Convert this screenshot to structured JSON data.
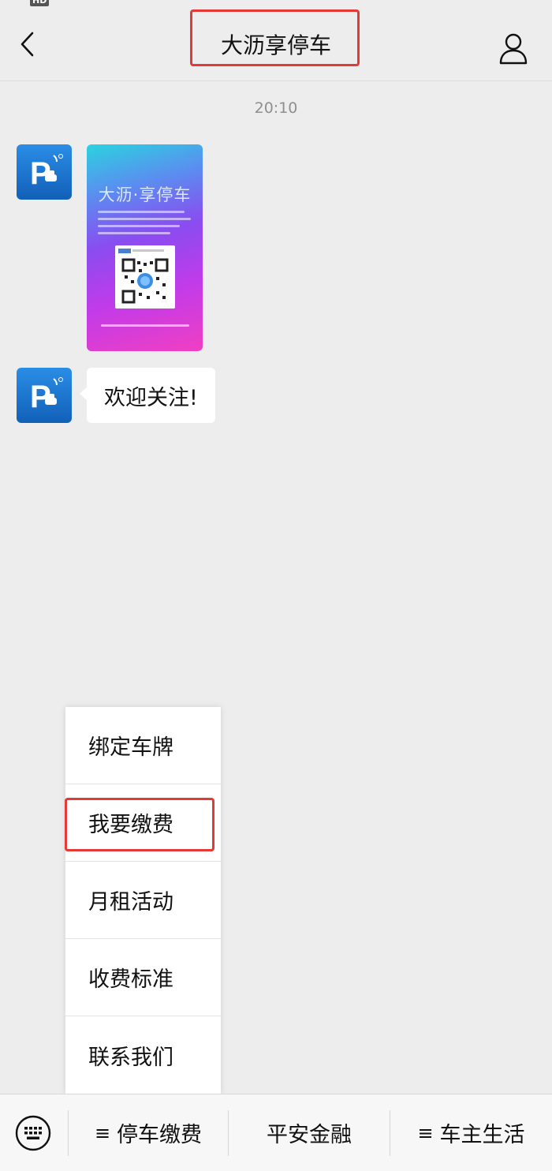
{
  "header": {
    "title": "大沥享停车"
  },
  "chat": {
    "timestamp": "20:10",
    "poster_title": "大沥·享停车",
    "welcome_text": "欢迎关注!"
  },
  "popup_menu": {
    "items": [
      "绑定车牌",
      "我要缴费",
      "月租活动",
      "收费标准",
      "联系我们"
    ],
    "highlighted": "我要缴费"
  },
  "bottom_menu": {
    "items": [
      {
        "label": "停车缴费",
        "has_submenu": true
      },
      {
        "label": "平安金融",
        "has_submenu": false
      },
      {
        "label": "车主生活",
        "has_submenu": true
      }
    ],
    "submenu_glyph": "≡"
  },
  "icons": {
    "back": "chevron-left-icon",
    "profile": "person-icon",
    "keyboard": "keyboard-icon",
    "avatar": "parking-logo"
  },
  "colors": {
    "highlight": "#e53935",
    "background": "#ededed",
    "avatar_blue": "#1a73d8"
  }
}
